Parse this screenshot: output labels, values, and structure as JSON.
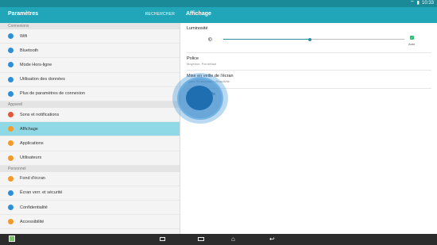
{
  "status_bar": {
    "time": "10:33",
    "wifi_icon": "wifi-icon",
    "battery_icon": "battery-icon"
  },
  "left_header": {
    "title": "Paramètres",
    "action": "RECHERCHER"
  },
  "right_header": {
    "title": "Affichage"
  },
  "sections": [
    {
      "header": "Connexions",
      "items": [
        {
          "label": "Wifi",
          "icon": "wifi-icon",
          "color": "#2f8fd6"
        },
        {
          "label": "Bluetooth",
          "icon": "bluetooth-icon",
          "color": "#2f8fd6"
        },
        {
          "label": "Mode Hors-ligne",
          "icon": "airplane-icon",
          "color": "#2f8fd6"
        },
        {
          "label": "Utilisation des données",
          "icon": "data-usage-icon",
          "color": "#2f8fd6"
        },
        {
          "label": "Plus de paramètres de connexion",
          "icon": "more-connections-icon",
          "color": "#2f8fd6"
        }
      ]
    },
    {
      "header": "Appareil",
      "items": [
        {
          "label": "Sons et notifications",
          "icon": "sound-icon",
          "color": "#e2573a"
        },
        {
          "label": "Affichage",
          "icon": "display-icon",
          "color": "#f39a2b",
          "selected": true
        },
        {
          "label": "Applications",
          "icon": "apps-icon",
          "color": "#f39a2b"
        },
        {
          "label": "Utilisateurs",
          "icon": "users-icon",
          "color": "#f39a2b"
        }
      ]
    },
    {
      "header": "Personnel",
      "items": [
        {
          "label": "Fond d'écran",
          "icon": "wallpaper-icon",
          "color": "#f39a2b"
        },
        {
          "label": "Écran verr. et sécurité",
          "icon": "lock-icon",
          "color": "#2f8fd6"
        },
        {
          "label": "Confidentialité",
          "icon": "privacy-icon",
          "color": "#2f8fd6"
        },
        {
          "label": "Accessibilité",
          "icon": "accessibility-icon",
          "color": "#f39a2b"
        }
      ]
    }
  ],
  "display": {
    "brightness": {
      "label": "Luminosité",
      "value_fraction": 0.48,
      "auto_label": "Auto",
      "auto_checked": true
    },
    "font": {
      "title": "Police",
      "subtitle": "Moyenne, Par défaut"
    },
    "sleep": {
      "title": "Mise en veille de l'écran",
      "subtitle": "Après 30 secondes d'inactivité"
    },
    "saver": {
      "title": "Écran de veille",
      "subtitle": "Désactivé"
    }
  },
  "nav_bar": {
    "gallery_icon": "gallery-icon",
    "recent_icon": "recent-apps-icon",
    "multiwindow_icon": "multi-window-icon",
    "home_icon": "home-icon",
    "back_icon": "back-icon"
  }
}
